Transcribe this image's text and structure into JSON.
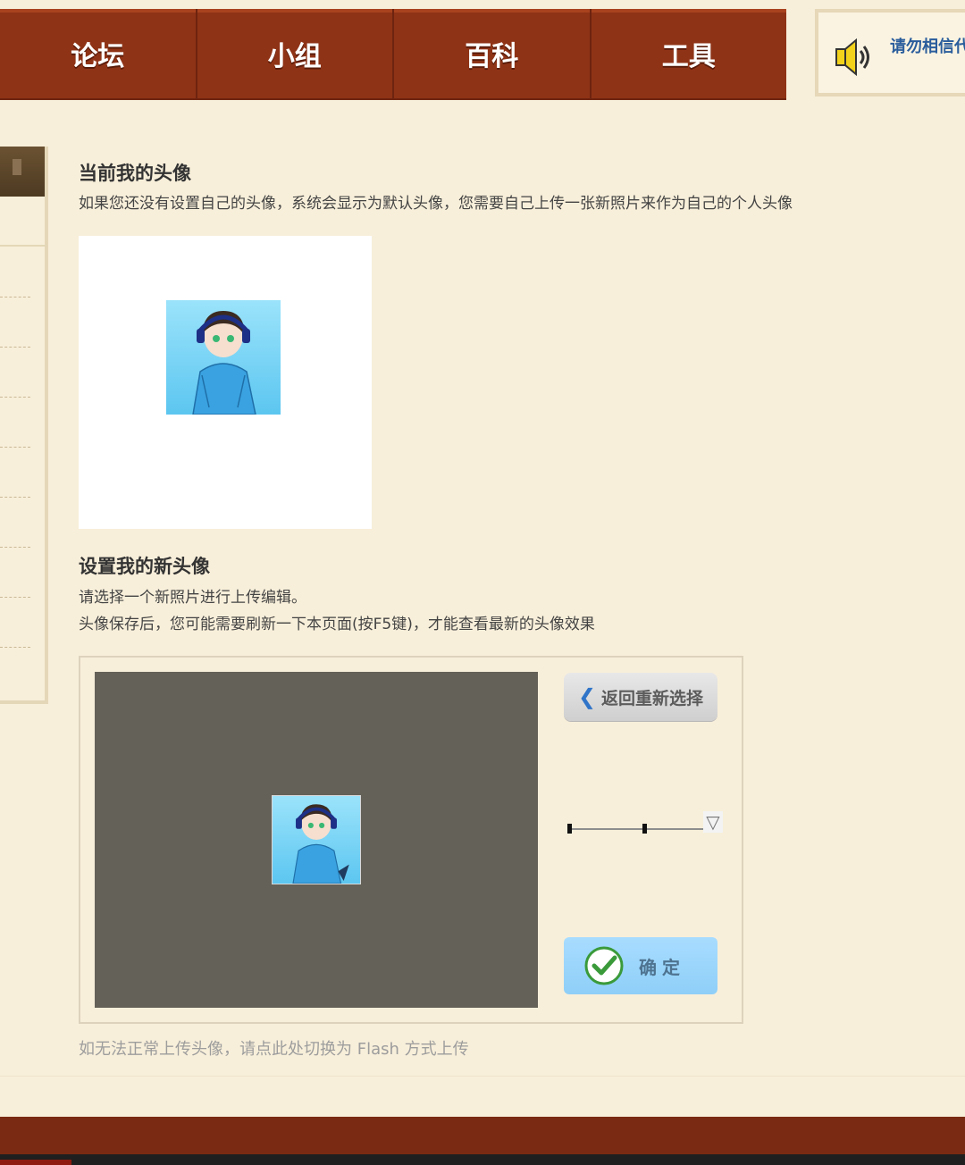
{
  "nav": {
    "items": [
      {
        "label": "论坛"
      },
      {
        "label": "小组"
      },
      {
        "label": "百科"
      },
      {
        "label": "工具"
      }
    ]
  },
  "notice": {
    "icon": "speaker-icon",
    "text": "请勿相信代"
  },
  "current_avatar": {
    "title": "当前我的头像",
    "description": "如果您还没有设置自己的头像，系统会显示为默认头像，您需要自己上传一张新照片来作为自己的个人头像"
  },
  "new_avatar": {
    "title": "设置我的新头像",
    "line1": "请选择一个新照片进行上传编辑。",
    "line2": "头像保存后，您可能需要刷新一下本页面(按F5键)，才能查看最新的头像效果"
  },
  "editor": {
    "back_label": "返回重新选择",
    "confirm_label": "确定",
    "zoom_level": 0.55
  },
  "flash_link": "如无法正常上传头像，请点此处切换为 Flash 方式上传",
  "colors": {
    "nav_bg": "#8f3316",
    "page_bg": "#f8efda",
    "canvas_bg": "#646158",
    "confirm_bg": "#9ed6fd",
    "link_blue": "#2a5d9c"
  }
}
